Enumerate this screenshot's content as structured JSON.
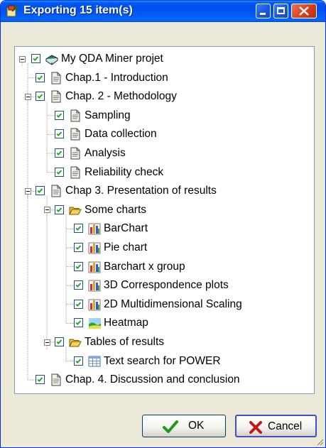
{
  "window": {
    "title": "Exporting 15 item(s)"
  },
  "colors": {
    "title_bar": "#0054e3",
    "check": "#21a121",
    "folder": "#f5d35a",
    "document": "#f4f0e6"
  },
  "tree": [
    {
      "label": "My QDA Miner projet",
      "icon": "book-icon",
      "checked": true,
      "expander": "minus"
    },
    {
      "label": "Chap.1 - Introduction",
      "icon": "document-icon",
      "checked": true
    },
    {
      "label": "Chap. 2 - Methodology",
      "icon": "document-icon",
      "checked": true,
      "expander": "minus"
    },
    {
      "label": "Sampling",
      "icon": "document-icon",
      "checked": true
    },
    {
      "label": "Data collection",
      "icon": "document-icon",
      "checked": true
    },
    {
      "label": "Analysis",
      "icon": "document-icon",
      "checked": true
    },
    {
      "label": "Reliability check",
      "icon": "document-icon",
      "checked": true
    },
    {
      "label": "Chap 3. Presentation of results",
      "icon": "document-icon",
      "checked": true,
      "expander": "minus"
    },
    {
      "label": "Some charts",
      "icon": "folder-open-icon",
      "checked": true,
      "expander": "minus"
    },
    {
      "label": "BarChart",
      "icon": "bar-chart-icon",
      "checked": true
    },
    {
      "label": "Pie chart",
      "icon": "bar-chart-icon",
      "checked": true
    },
    {
      "label": "Barchart x group",
      "icon": "bar-chart-icon",
      "checked": true
    },
    {
      "label": "3D Correspondence plots",
      "icon": "bar-chart-icon",
      "checked": true
    },
    {
      "label": "2D Multidimensional Scaling",
      "icon": "bar-chart-icon",
      "checked": true
    },
    {
      "label": "Heatmap",
      "icon": "heatmap-icon",
      "checked": true
    },
    {
      "label": "Tables of results",
      "icon": "folder-open-icon",
      "checked": true,
      "expander": "minus"
    },
    {
      "label": "Text search for POWER",
      "icon": "table-icon",
      "checked": true
    },
    {
      "label": "Chap. 4. Discussion and conclusion",
      "icon": "document-icon",
      "checked": true
    }
  ],
  "buttons": {
    "ok": "OK",
    "cancel": "Cancel"
  }
}
